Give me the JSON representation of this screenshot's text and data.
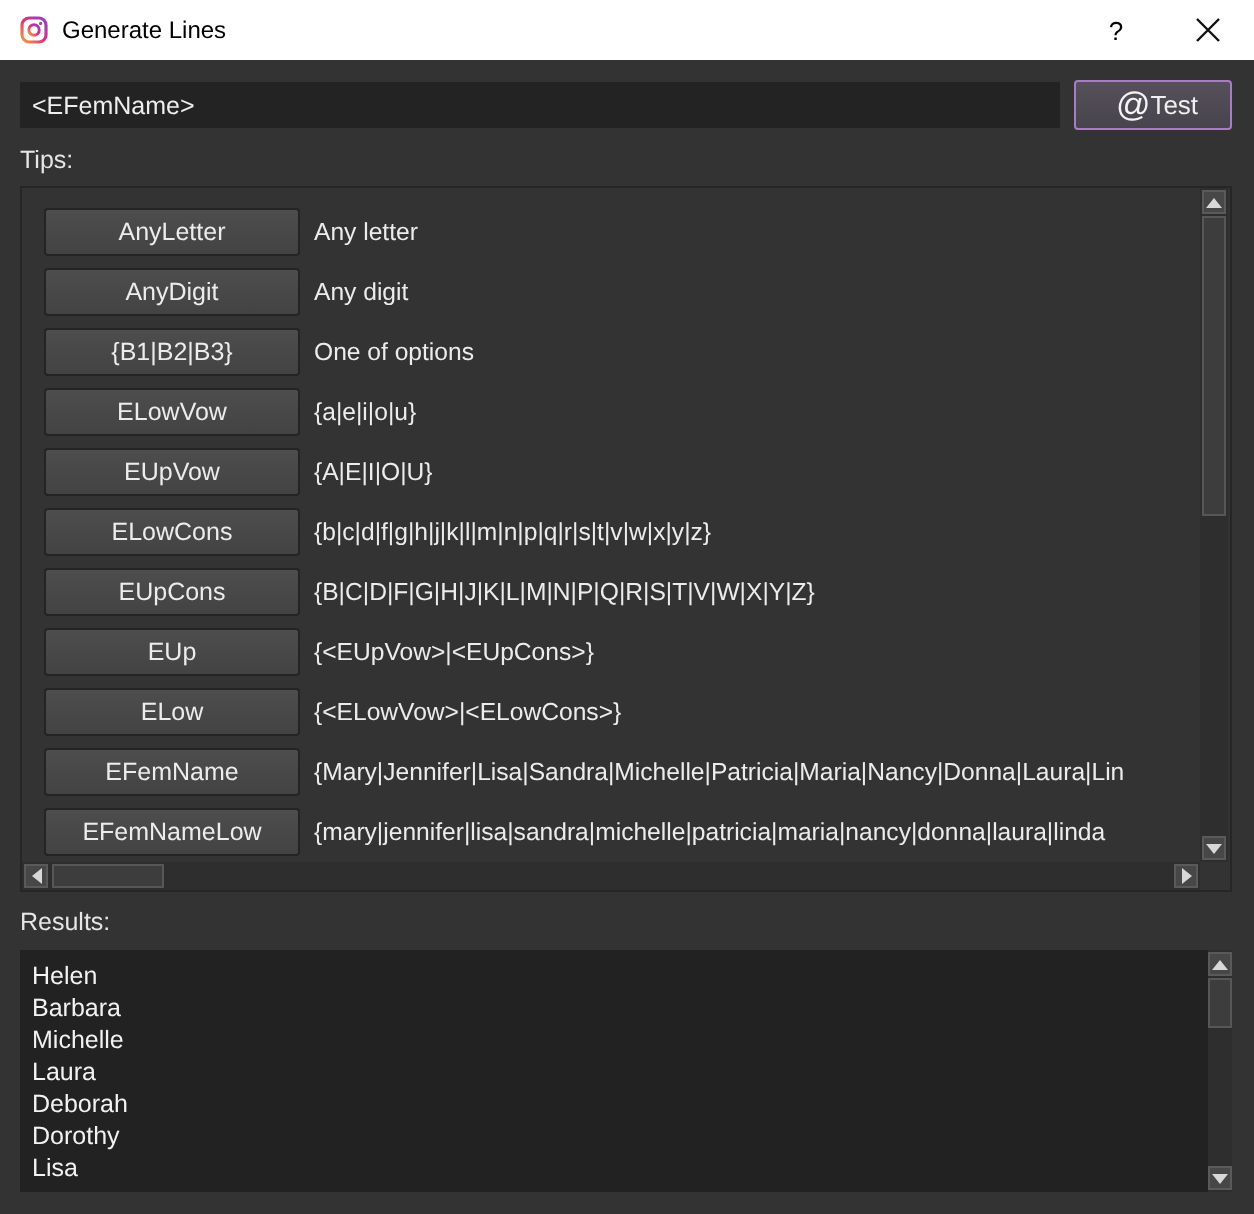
{
  "window": {
    "title": "Generate Lines",
    "help": "?"
  },
  "pattern_field": {
    "value": "<EFemName>"
  },
  "test_button": {
    "icon": "@",
    "label": "Test"
  },
  "tips": {
    "label": "Tips:",
    "items": [
      {
        "token": "AnyLetter",
        "description": "Any letter"
      },
      {
        "token": "AnyDigit",
        "description": "Any digit"
      },
      {
        "token": "{B1|B2|B3}",
        "description": "One of options"
      },
      {
        "token": "ELowVow",
        "description": "{a|e|i|o|u}"
      },
      {
        "token": "EUpVow",
        "description": "{A|E|I|O|U}"
      },
      {
        "token": "ELowCons",
        "description": "{b|c|d|f|g|h|j|k|l|m|n|p|q|r|s|t|v|w|x|y|z}"
      },
      {
        "token": "EUpCons",
        "description": "{B|C|D|F|G|H|J|K|L|M|N|P|Q|R|S|T|V|W|X|Y|Z}"
      },
      {
        "token": "EUp",
        "description": "{<EUpVow>|<EUpCons>}"
      },
      {
        "token": "ELow",
        "description": "{<ELowVow>|<ELowCons>}"
      },
      {
        "token": "EFemName",
        "description": "{Mary|Jennifer|Lisa|Sandra|Michelle|Patricia|Maria|Nancy|Donna|Laura|Lin"
      },
      {
        "token": "EFemNameLow",
        "description": "{mary|jennifer|lisa|sandra|michelle|patricia|maria|nancy|donna|laura|linda"
      }
    ]
  },
  "results": {
    "label": "Results:",
    "lines": [
      "Helen",
      "Barbara",
      "Michelle",
      "Laura",
      "Deborah",
      "Dorothy",
      "Lisa"
    ]
  }
}
